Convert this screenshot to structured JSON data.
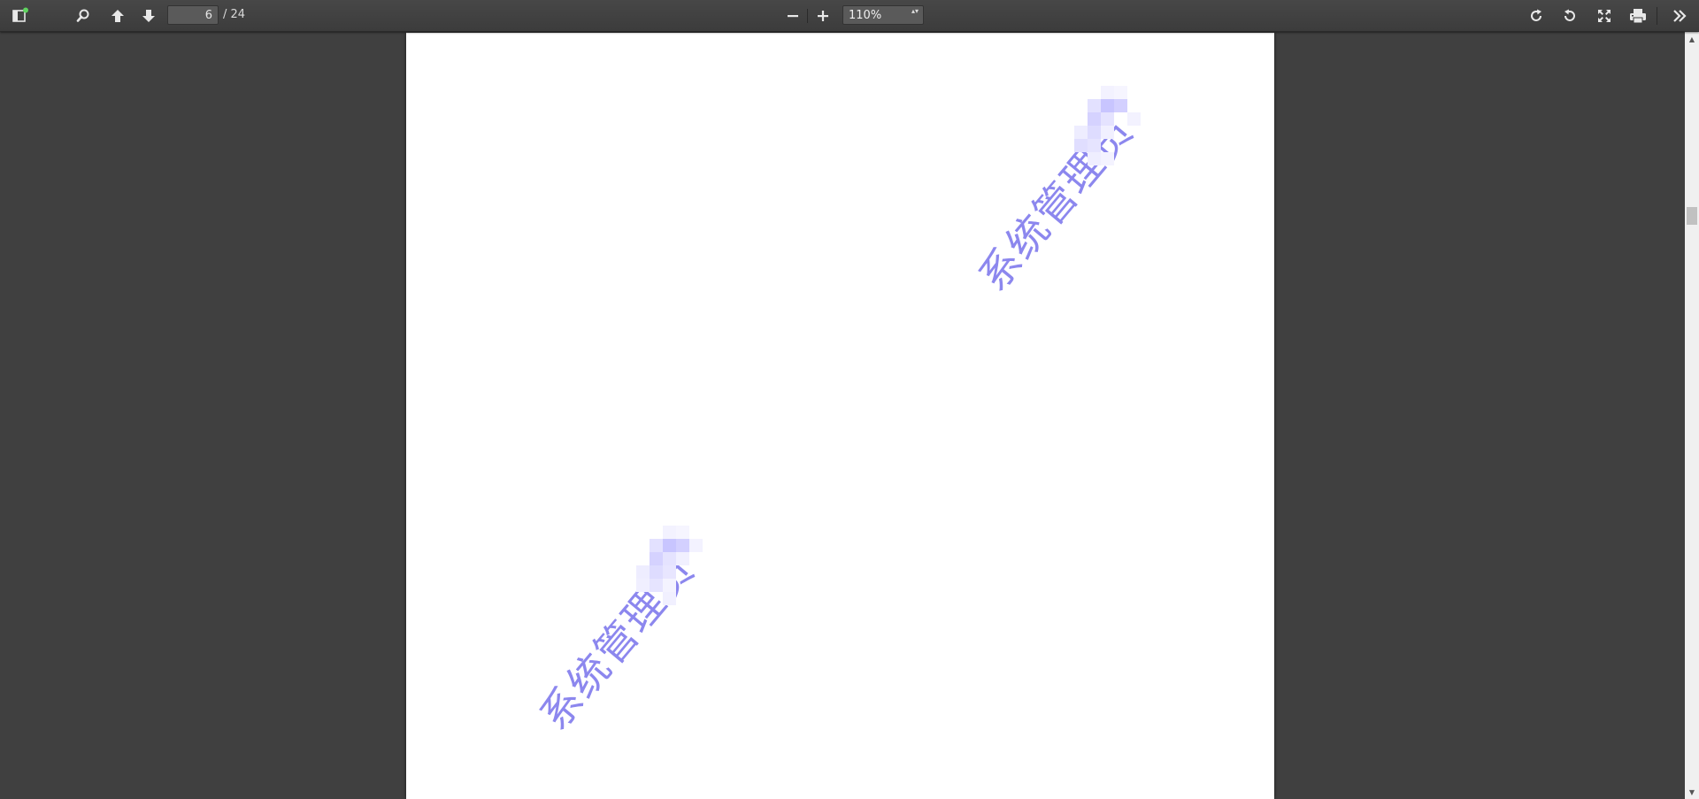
{
  "toolbar": {
    "page_current": "6",
    "page_total": "/ 24",
    "zoom_value": "110%",
    "zoom_arrows": "▴▾"
  },
  "icons": {
    "sidebar": "sidebar-toggle-icon",
    "search": "search-icon",
    "prev": "arrow-up-icon",
    "next": "arrow-down-icon",
    "zoom_out": "minus-icon",
    "zoom_in": "plus-icon",
    "rotate_cw": "rotate-clockwise-icon",
    "rotate_ccw": "rotate-counterclockwise-icon",
    "fullscreen": "fullscreen-icon",
    "print": "print-icon",
    "more": "double-chevron-right-icon"
  },
  "document": {
    "watermark_text": "系统管理员"
  },
  "colors": {
    "watermark": "#8c87ee",
    "notification_dot": "#5fd35f"
  }
}
